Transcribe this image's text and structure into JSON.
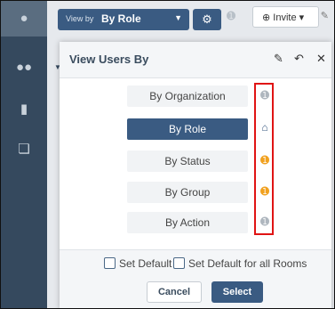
{
  "topbar": {
    "view_by_prefix": "View by",
    "view_by_value": "By Role",
    "invite_label": "Invite"
  },
  "modal": {
    "title": "View Users By",
    "options": [
      {
        "label": "By Organization",
        "selected": false,
        "pin": "gray"
      },
      {
        "label": "By Role",
        "selected": true,
        "pin": "home"
      },
      {
        "label": "By Status",
        "selected": false,
        "pin": "orange"
      },
      {
        "label": "By Group",
        "selected": false,
        "pin": "orange"
      },
      {
        "label": "By Action",
        "selected": false,
        "pin": "gray"
      }
    ],
    "set_default_label": "Set Default",
    "set_default_all_label": "Set Default for all Rooms",
    "cancel_label": "Cancel",
    "select_label": "Select"
  },
  "colors": {
    "sidebar": "#35495e",
    "primary": "#3a5b82",
    "pin_orange": "#f1a11f",
    "pin_gray": "#aeb6be",
    "highlight": "#e01414"
  },
  "icons": {
    "sidebar": [
      "user-icon",
      "users-icon",
      "building-icon",
      "documents-icon"
    ],
    "header": [
      "edit-icon",
      "undo-icon",
      "close-icon"
    ]
  }
}
